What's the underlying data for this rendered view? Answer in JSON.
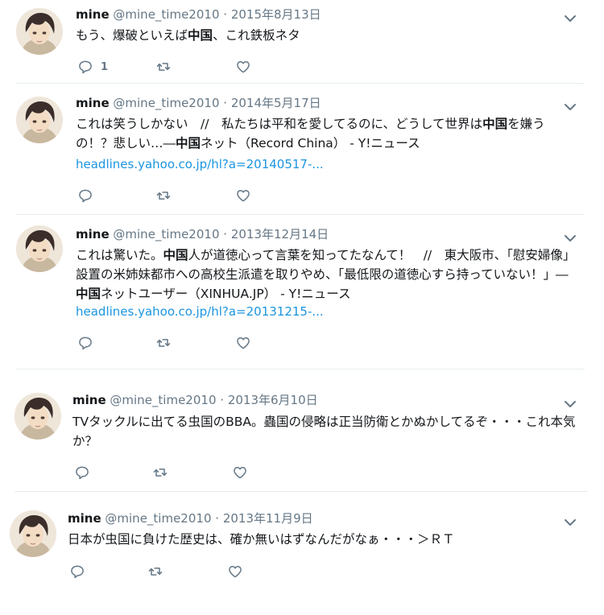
{
  "tweets": [
    {
      "name": "mine",
      "handle": "@mine_time2010",
      "sep": "·",
      "date": "2015年8月13日",
      "text": [
        {
          "t": "もう、爆破といえば",
          "b": false
        },
        {
          "t": "中国",
          "b": true
        },
        {
          "t": "、これ鉄板ネタ",
          "b": false
        }
      ],
      "link": "",
      "reply_count": "1"
    },
    {
      "name": "mine",
      "handle": "@mine_time2010",
      "sep": "·",
      "date": "2014年5月17日",
      "text": [
        {
          "t": "これは笑うしかない　//　私たちは平和を愛してるのに、どうして世界は",
          "b": false
        },
        {
          "t": "中国",
          "b": true
        },
        {
          "t": "を嫌うの！？悲しい…―",
          "b": false
        },
        {
          "t": "中国",
          "b": true
        },
        {
          "t": "ネット（Record China） - Y!ニュース",
          "b": false
        }
      ],
      "link": "headlines.yahoo.co.jp/hl?a=20140517-...",
      "reply_count": ""
    },
    {
      "name": "mine",
      "handle": "@mine_time2010",
      "sep": "·",
      "date": "2013年12月14日",
      "text": [
        {
          "t": "これは驚いた。",
          "b": false
        },
        {
          "t": "中国",
          "b": true
        },
        {
          "t": "人が道徳心って言葉を知ってたなんて！　//　東大阪市、「慰安婦像」設置の米姉妹都市への高校生派遣を取りやめ、「最低限の道徳心すら持っていない！」―",
          "b": false
        },
        {
          "t": "中国",
          "b": true
        },
        {
          "t": "ネットユーザー（XINHUA.JP） - Y!ニュース",
          "b": false
        }
      ],
      "link": "headlines.yahoo.co.jp/hl?a=20131215-...",
      "reply_count": ""
    },
    {
      "name": "mine",
      "handle": "@mine_time2010",
      "sep": "·",
      "date": "2013年6月10日",
      "text": [
        {
          "t": "TVタックルに出てる虫国のBBA。蟲国の侵略は正当防衛とかぬかしてるぞ・・・これ本気か？",
          "b": false
        }
      ],
      "link": "",
      "reply_count": ""
    },
    {
      "name": "mine",
      "handle": "@mine_time2010",
      "sep": "·",
      "date": "2013年11月9日",
      "text": [
        {
          "t": "日本が虫国に負けた歴史は、確か無いはずなんだがなぁ・・・＞ＲＴ",
          "b": false
        }
      ],
      "link": "",
      "reply_count": ""
    }
  ],
  "icons": {
    "reply": "reply-icon",
    "retweet": "retweet-icon",
    "like": "heart-icon",
    "more": "chevron-down-icon"
  },
  "colors": {
    "link": "#1b95e0",
    "secondary": "#657786",
    "separator": "#e6ecf0"
  }
}
